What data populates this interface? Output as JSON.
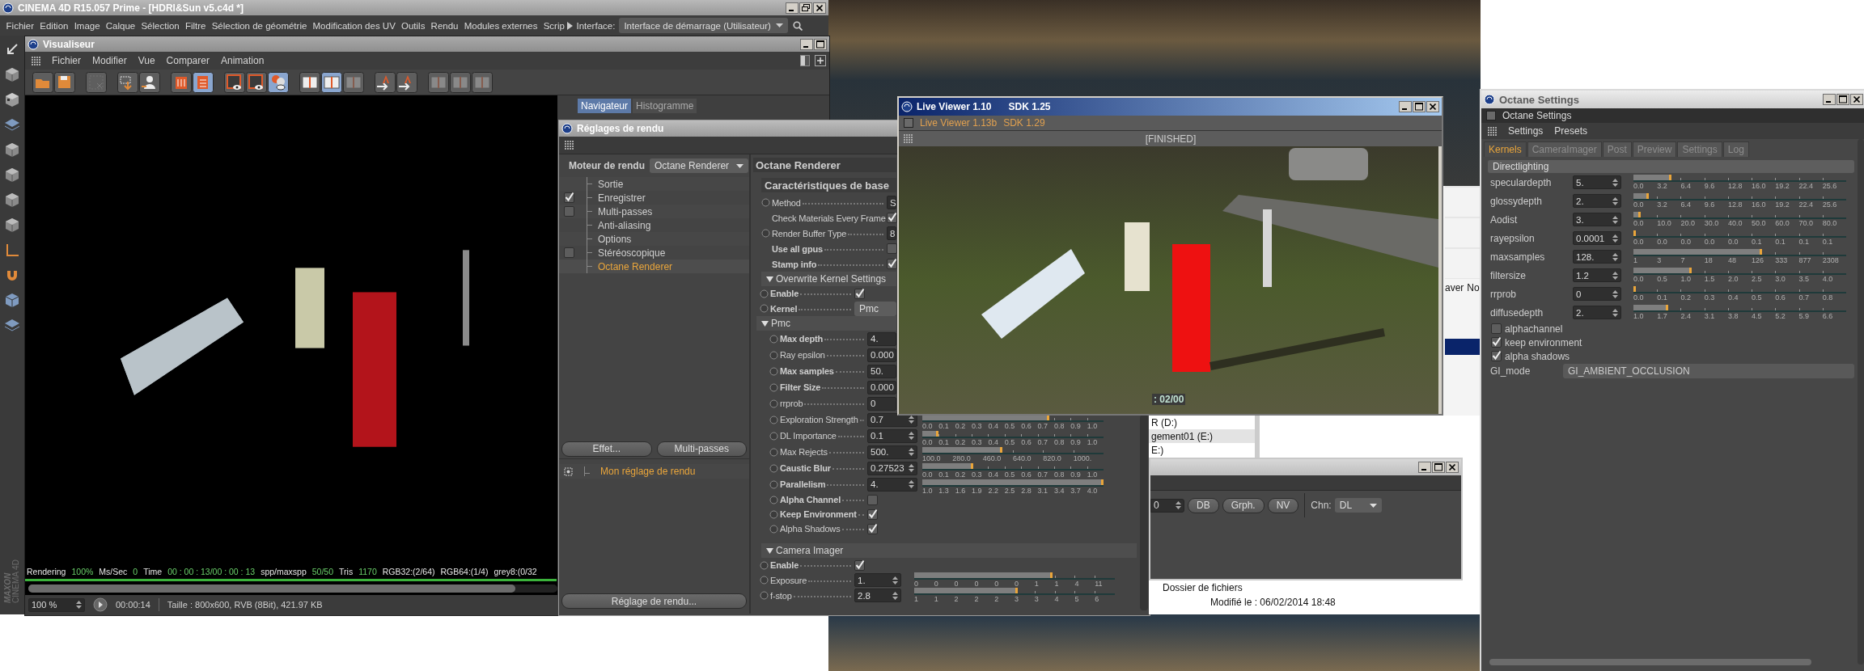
{
  "app": {
    "title": "CINEMA 4D R15.057 Prime - [HDRI&Sun v5.c4d *]",
    "menu": [
      "Fichier",
      "Edition",
      "Image",
      "Calque",
      "Sélection",
      "Filtre",
      "Sélection de géométrie",
      "Modification des UV",
      "Outils",
      "Rendu",
      "Modules externes",
      "Scrip"
    ],
    "interface_label": "Interface:",
    "interface_value": "Interface de démarrage (Utilisateur)",
    "logo": [
      "MAXON",
      "CINEMA 4D"
    ]
  },
  "viewer": {
    "title": "Visualiseur",
    "menu": [
      "Fichier",
      "Modifier",
      "Vue",
      "Comparer",
      "Animation"
    ],
    "toolbar": [
      [
        {
          "selected": false,
          "disabled": false
        },
        {
          "selected": false,
          "disabled": false
        }
      ],
      [
        {
          "selected": false,
          "disabled": true
        }
      ],
      [
        {
          "selected": false,
          "disabled": false
        },
        {
          "selected": false,
          "disabled": false
        }
      ],
      [
        {
          "selected": false,
          "disabled": false
        },
        {
          "selected": true,
          "disabled": false
        }
      ],
      [
        {
          "selected": false,
          "disabled": false
        },
        {
          "selected": false,
          "disabled": false
        },
        {
          "selected": true,
          "disabled": false
        }
      ],
      [
        {
          "selected": false,
          "disabled": false
        },
        {
          "selected": true,
          "disabled": false
        },
        {
          "selected": false,
          "disabled": true
        }
      ],
      [
        {
          "selected": false,
          "disabled": false
        },
        {
          "selected": false,
          "disabled": false
        }
      ],
      [
        {
          "selected": false,
          "disabled": true
        },
        {
          "selected": false,
          "disabled": true
        },
        {
          "selected": false,
          "disabled": true
        }
      ]
    ],
    "tabs": [
      {
        "label": "Navigateur",
        "selected": true
      },
      {
        "label": "Histogramme",
        "selected": false
      }
    ],
    "stats": [
      {
        "label": "Rendering",
        "value": "100%"
      },
      {
        "label": "Ms/Sec",
        "value": "0"
      },
      {
        "label": "Time",
        "value": "00 : 00 : 13/00 : 00 : 13"
      },
      {
        "label": "spp/maxspp",
        "value": "50/50"
      },
      {
        "label": "Tris",
        "value": "1170"
      },
      {
        "label": "RGB32:(2/64)"
      },
      {
        "label": "RGB64:(1/4)"
      },
      {
        "label": "grey8:(0/32"
      }
    ],
    "progress": {
      "level": 1
    },
    "zoom": "100 %",
    "elapsed": "00:00:14",
    "info": "Taille : 800x600, RVB (8Bit), 421.97 KB"
  },
  "render_settings": {
    "title": "Réglages de rendu",
    "engine_label": "Moteur de rendu",
    "engine": "Octane Renderer",
    "tree": [
      {
        "label": "Sortie",
        "kind": "plain",
        "selected": false
      },
      {
        "label": "Enregistrer",
        "kind": "checkbox",
        "checked": true,
        "selected": false
      },
      {
        "label": "Multi-passes",
        "kind": "checkbox",
        "checked": false,
        "selected": false
      },
      {
        "label": "Anti-aliasing",
        "kind": "plain",
        "selected": false
      },
      {
        "label": "Options",
        "kind": "plain",
        "selected": false
      },
      {
        "label": "Stéréoscopique",
        "kind": "checkbox",
        "checked": false,
        "selected": false
      },
      {
        "label": "Octane Renderer",
        "kind": "plain",
        "selected": true
      }
    ],
    "buttons": [
      "Effet...",
      "Multi-passes"
    ],
    "presets": [
      {
        "label": "Mon réglage de rendu",
        "selected": true
      }
    ],
    "bottom_button": "Réglage de rendu...",
    "panel_title": "Octane Renderer",
    "section": "Caractéristiques de base",
    "params": [
      {
        "kind": "field",
        "label": "Method",
        "radio": true,
        "bold": false,
        "value": "S"
      },
      {
        "kind": "check",
        "label": "Check Materials Every Frame",
        "radio": false,
        "bold": false,
        "checked": true
      },
      {
        "kind": "field",
        "label": "Render Buffer Type",
        "radio": true,
        "bold": false,
        "value": "8"
      },
      {
        "kind": "check",
        "label": "Use all gpus",
        "radio": false,
        "bold": true,
        "checked": false
      },
      {
        "kind": "check",
        "label": "Stamp info",
        "radio": false,
        "bold": true,
        "checked": true
      },
      {
        "kind": "group",
        "label": "Overwrite Kernel Settings",
        "expanded": true,
        "children": [
          {
            "kind": "check",
            "label": "Enable",
            "radio": true,
            "bold": true,
            "checked": true
          },
          {
            "kind": "dropdown",
            "label": "Kernel",
            "radio": true,
            "bold": true,
            "value": "Pmc"
          },
          {
            "kind": "group",
            "label": "Pmc",
            "expanded": true,
            "children": [
              {
                "kind": "field",
                "label": "Max depth",
                "radio": true,
                "bold": true,
                "value": "4."
              },
              {
                "kind": "field",
                "label": "Ray epsilon",
                "radio": true,
                "bold": false,
                "value": "0.000"
              },
              {
                "kind": "field",
                "label": "Max samples",
                "radio": true,
                "bold": true,
                "value": "50."
              },
              {
                "kind": "field",
                "label": "Filter Size",
                "radio": true,
                "bold": true,
                "value": "0.000"
              },
              {
                "kind": "field",
                "label": "rrprob",
                "radio": true,
                "bold": false,
                "value": "0"
              },
              {
                "kind": "slider",
                "label": "Exploration Strength",
                "radio": true,
                "bold": false,
                "value": "0.7",
                "level": 0.7,
                "ticks": [
                  "0.0",
                  "0.1",
                  "0.2",
                  "0.3",
                  "0.4",
                  "0.5",
                  "0.6",
                  "0.7",
                  "0.8",
                  "0.9",
                  "1.0"
                ]
              },
              {
                "kind": "slider",
                "label": "DL Importance",
                "radio": true,
                "bold": false,
                "value": "0.1",
                "level": 0.09,
                "ticks": [
                  "0.0",
                  "0.1",
                  "0.2",
                  "0.3",
                  "0.4",
                  "0.5",
                  "0.6",
                  "0.7",
                  "0.8",
                  "0.9",
                  "1.0"
                ]
              },
              {
                "kind": "slider",
                "label": "Max Rejects",
                "radio": true,
                "bold": false,
                "value": "500.",
                "level": 0.44,
                "ticks": [
                  "100.0",
                  "280.0",
                  "460.0",
                  "640.0",
                  "820.0",
                  "1000."
                ]
              },
              {
                "kind": "slider",
                "label": "Caustic Blur",
                "radio": true,
                "bold": true,
                "value": "0.27523",
                "level": 0.28,
                "ticks": [
                  "0.0",
                  "0.1",
                  "0.2",
                  "0.3",
                  "0.4",
                  "0.5",
                  "0.6",
                  "0.7",
                  "0.8",
                  "0.9",
                  "1.0"
                ]
              },
              {
                "kind": "slider",
                "label": "Parallelism",
                "radio": true,
                "bold": true,
                "value": "4.",
                "level": 1,
                "ticks": [
                  "1.0",
                  "1.3",
                  "1.6",
                  "1.9",
                  "2.2",
                  "2.5",
                  "2.8",
                  "3.1",
                  "3.4",
                  "3.7",
                  "4.0"
                ]
              },
              {
                "kind": "check",
                "label": "Alpha Channel",
                "radio": true,
                "bold": true,
                "checked": false
              },
              {
                "kind": "check",
                "label": "Keep Environment",
                "radio": true,
                "bold": true,
                "checked": true
              },
              {
                "kind": "check",
                "label": "Alpha Shadows",
                "radio": true,
                "bold": false,
                "checked": true
              }
            ]
          }
        ]
      },
      {
        "kind": "group",
        "label": "Camera Imager",
        "expanded": true,
        "children": [
          {
            "kind": "check",
            "label": "Enable",
            "radio": true,
            "bold": true,
            "checked": true
          },
          {
            "kind": "slider",
            "label": "Exposure",
            "radio": true,
            "bold": false,
            "value": "1.",
            "level": 0.69,
            "ticks": [
              "0",
              "0",
              "0",
              "0",
              "0",
              "0",
              "1",
              "1",
              "4",
              "11"
            ]
          },
          {
            "kind": "slider",
            "label": "f-stop",
            "radio": true,
            "bold": false,
            "value": "2.8",
            "level": 0.515,
            "ticks": [
              "1",
              "1",
              "2",
              "2",
              "2",
              "3",
              "3",
              "4",
              "5",
              "6"
            ]
          }
        ]
      }
    ]
  },
  "live_viewer": {
    "title": "Live Viewer 1.10",
    "sdk": "SDK 1.25",
    "subtitle": "Live Viewer 1.13b",
    "subtitle_sdk": "SDK 1.29",
    "status": "[FINISHED]",
    "frame": ": 02/00"
  },
  "explorer": {
    "columns": [
      "aver",
      "No"
    ],
    "drives": [
      {
        "label": "R (D:)",
        "selected": false
      },
      {
        "label": "gement01 (E:)",
        "selected": true
      },
      {
        "label": "E:)",
        "selected": false
      }
    ],
    "type": "Dossier de fichiers",
    "modified": "Modifié le : 06/02/2014 18:48"
  },
  "octane_mini": {
    "value": "0",
    "buttons": [
      "DB",
      "Grph.",
      "NV"
    ],
    "channel_label": "Chn:",
    "channel": "DL"
  },
  "octane_settings": {
    "title": "Octane Settings",
    "subtitle": "Octane Settings",
    "menu": [
      "Settings",
      "Presets"
    ],
    "tabs": [
      {
        "label": "Kernels",
        "selected": true
      },
      {
        "label": "CameraImager",
        "selected": false
      },
      {
        "label": "Post",
        "selected": false
      },
      {
        "label": "Preview",
        "selected": false
      },
      {
        "label": "Settings",
        "selected": false
      },
      {
        "label": "Log",
        "selected": false
      }
    ],
    "section": "Directlighting",
    "params": [
      {
        "label": "speculardepth",
        "value": "5.",
        "level": 0.178,
        "ticks": [
          "0.0",
          "3.2",
          "6.4",
          "9.6",
          "12.8",
          "16.0",
          "19.2",
          "22.4",
          "25.6"
        ]
      },
      {
        "label": "glossydepth",
        "value": "2.",
        "level": 0.073,
        "ticks": [
          "0.0",
          "3.2",
          "6.4",
          "9.6",
          "12.8",
          "16.0",
          "19.2",
          "22.4",
          "25.6"
        ]
      },
      {
        "label": "Aodist",
        "value": "3.",
        "level": 0.033,
        "ticks": [
          "0.0",
          "10.0",
          "20.0",
          "30.0",
          "40.0",
          "50.0",
          "60.0",
          "70.0",
          "80.0"
        ]
      },
      {
        "label": "rayepsilon",
        "value": "0.0001",
        "level": 0,
        "ticks": [
          "0.0",
          "0.0",
          "0.0",
          "0.0",
          "0.0",
          "0.1",
          "0.1",
          "0.1",
          "0.1"
        ]
      },
      {
        "label": "maxsamples",
        "value": "128.",
        "level": 0.606,
        "ticks": [
          "1",
          "3",
          "7",
          "18",
          "48",
          "126",
          "333",
          "877",
          "2308"
        ]
      },
      {
        "label": "filtersize",
        "value": "1.2",
        "level": 0.275,
        "ticks": [
          "0.0",
          "0.5",
          "1.0",
          "1.5",
          "2.0",
          "2.5",
          "3.0",
          "3.5",
          "4.0"
        ]
      },
      {
        "label": "rrprob",
        "value": "0",
        "level": 0,
        "ticks": [
          "0.0",
          "0.1",
          "0.2",
          "0.3",
          "0.4",
          "0.5",
          "0.6",
          "0.7",
          "0.8"
        ]
      },
      {
        "label": "diffusedepth",
        "value": "2.",
        "level": 0.164,
        "ticks": [
          "1.0",
          "1.7",
          "2.4",
          "3.1",
          "3.8",
          "4.5",
          "5.2",
          "5.9",
          "6.6"
        ]
      }
    ],
    "checks": [
      {
        "label": "alphachannel",
        "checked": false
      },
      {
        "label": "keep environment",
        "checked": true
      },
      {
        "label": "alpha shadows",
        "checked": true
      }
    ],
    "mode_label": "GI_mode",
    "mode": "GI_AMBIENT_OCCLUSION"
  }
}
